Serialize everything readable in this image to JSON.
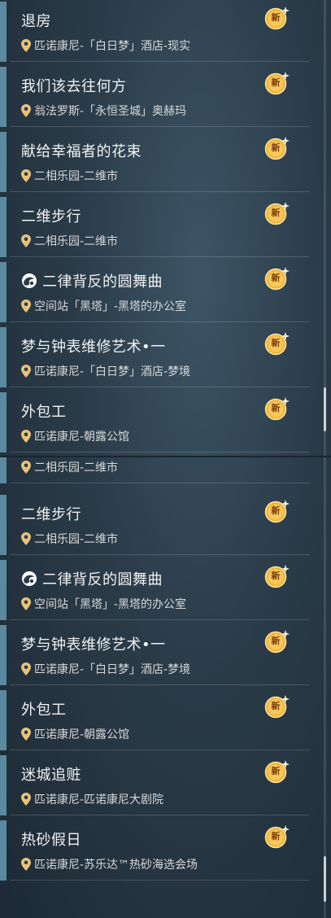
{
  "badge_label": "新",
  "colors": {
    "accent_bar": "#5a8aa0",
    "badge_gold": "#f0b33a",
    "title_text": "#f2f2f2",
    "location_text": "#d9d9d9"
  },
  "top_panel": {
    "quests": [
      {
        "title": "退房",
        "location": "匹诺康尼-「白日梦」酒店-现实",
        "icon": null
      },
      {
        "title": "我们该去往何方",
        "location": "翁法罗斯-「永恒圣城」奥赫玛",
        "icon": null
      },
      {
        "title": "献给幸福者的花束",
        "location": "二相乐园-二维市",
        "icon": null
      },
      {
        "title": "二维步行",
        "location": "二相乐园-二维市",
        "icon": null
      },
      {
        "title": "二律背反的圆舞曲",
        "location": "空间站「黑塔」-黑塔的办公室",
        "icon": "swirl-quest-icon"
      },
      {
        "title": "梦与钟表维修艺术•一",
        "location": "匹诺康尼-「白日梦」酒店-梦境",
        "icon": null
      },
      {
        "title": "外包工",
        "location": "匹诺康尼-朝露公馆",
        "icon": null
      }
    ]
  },
  "bottom_panel": {
    "partial_location": "二相乐园-二维市",
    "quests": [
      {
        "title": "二维步行",
        "location": "二相乐园-二维市",
        "icon": null
      },
      {
        "title": "二律背反的圆舞曲",
        "location": "空间站「黑塔」-黑塔的办公室",
        "icon": "swirl-quest-icon"
      },
      {
        "title": "梦与钟表维修艺术•一",
        "location": "匹诺康尼-「白日梦」酒店-梦境",
        "icon": null
      },
      {
        "title": "外包工",
        "location": "匹诺康尼-朝露公馆",
        "icon": null
      },
      {
        "title": "迷城追赃",
        "location": "匹诺康尼-匹诺康尼大剧院",
        "icon": null
      },
      {
        "title": "热砂假日",
        "location": "匹诺康尼-苏乐达™热砂海选会场",
        "icon": null
      }
    ]
  }
}
